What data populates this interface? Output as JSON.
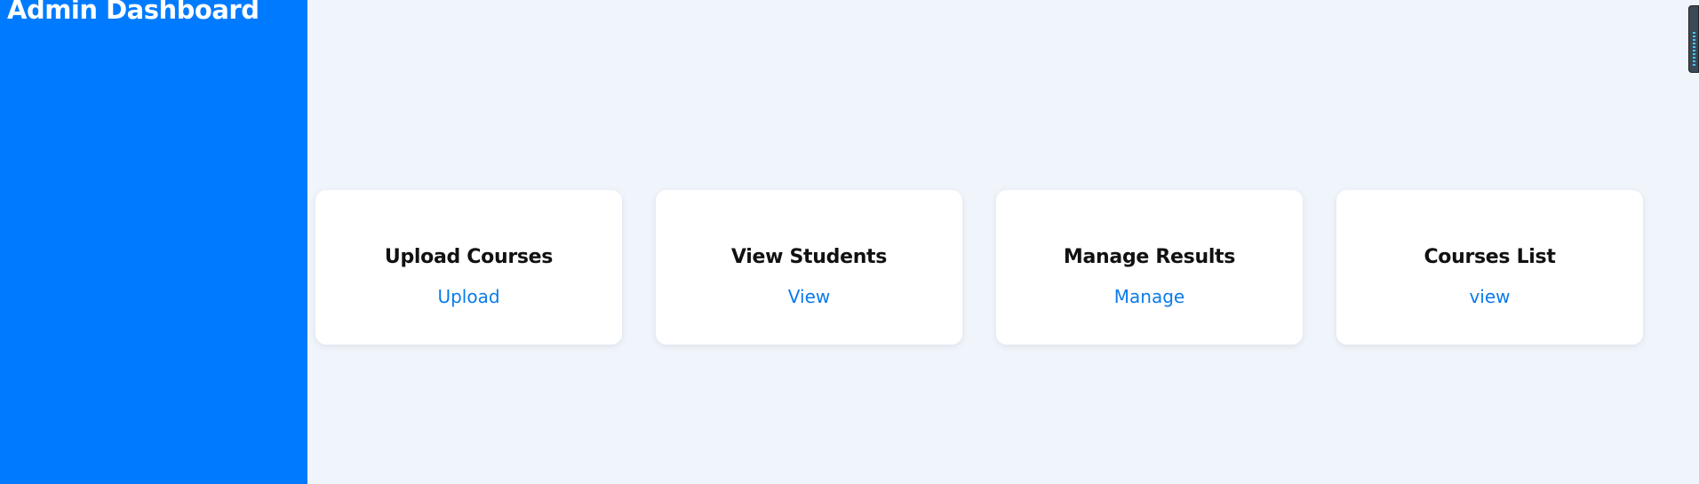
{
  "sidebar": {
    "title": "Admin Dashboard"
  },
  "cards": [
    {
      "title": "Upload Courses",
      "link": "Upload"
    },
    {
      "title": "View Students",
      "link": "View"
    },
    {
      "title": "Manage Results",
      "link": "Manage"
    },
    {
      "title": "Courses List",
      "link": "view"
    }
  ],
  "colors": {
    "sidebar_bg": "#007bff",
    "page_bg": "#f0f4fb",
    "link": "#0a7bea"
  }
}
